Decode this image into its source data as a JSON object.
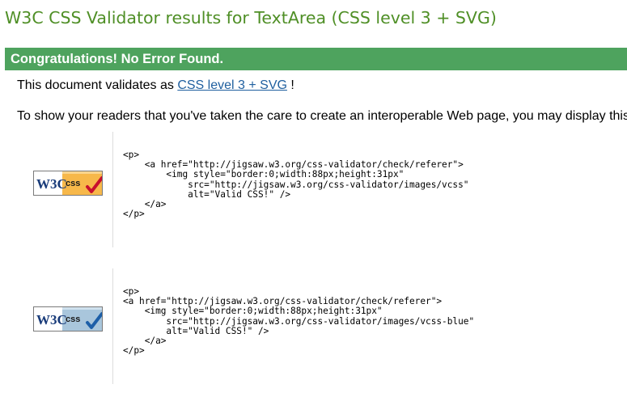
{
  "page_title": "W3C CSS Validator results for TextArea (CSS level 3 + SVG)",
  "congrats_text": "Congratulations! No Error Found.",
  "validates": {
    "prefix": "This document validates as ",
    "link_text": "CSS level 3 + SVG",
    "suffix": " !"
  },
  "readers_text": "To show your readers that you've taken the care to create an interoperable Web page, you may display this",
  "badges": [
    {
      "w3c_text": "W3C",
      "css_text": "css",
      "variant": "vcss",
      "check_color": "#c8102e",
      "panel_color": "#f7b84a",
      "code": "<p>\n    <a href=\"http://jigsaw.w3.org/css-validator/check/referer\">\n        <img style=\"border:0;width:88px;height:31px\"\n            src=\"http://jigsaw.w3.org/css-validator/images/vcss\"\n            alt=\"Valid CSS!\" />\n    </a>\n</p>"
    },
    {
      "w3c_text": "W3C",
      "css_text": "css",
      "variant": "vcss-blue",
      "check_color": "#1d5fa8",
      "panel_color": "#a9c6dc",
      "code": "<p>\n<a href=\"http://jigsaw.w3.org/css-validator/check/referer\">\n    <img style=\"border:0;width:88px;height:31px\"\n        src=\"http://jigsaw.w3.org/css-validator/images/vcss-blue\"\n        alt=\"Valid CSS!\" />\n    </a>\n</p>"
    }
  ],
  "colors": {
    "title_green": "#4f8f26",
    "congrats_bg": "#4ea35e",
    "link_blue": "#1f5f9f"
  }
}
